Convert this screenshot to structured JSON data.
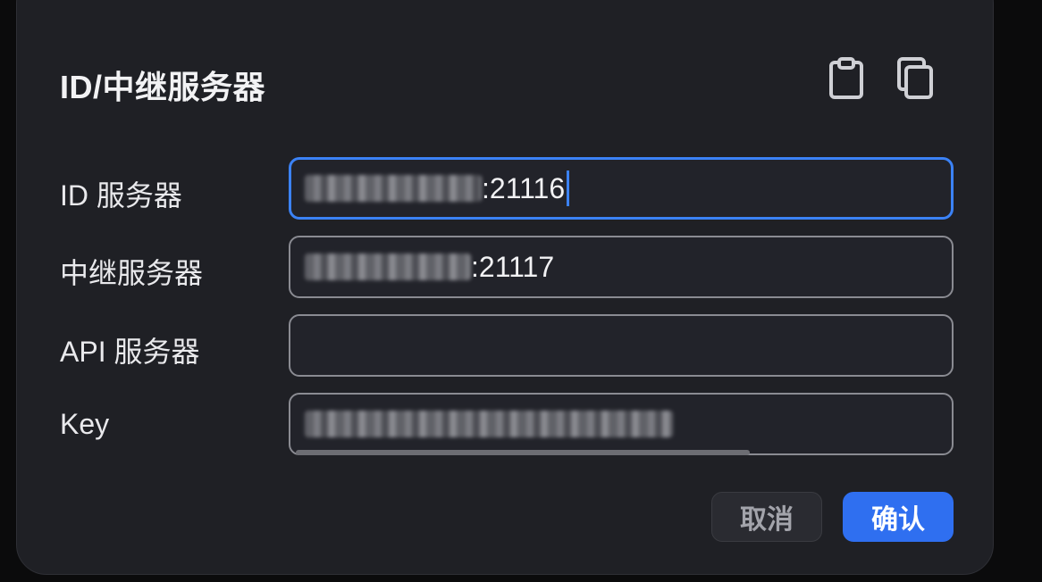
{
  "dialog": {
    "title": "ID/中继服务器",
    "icons": {
      "paste": "clipboard-paste-icon",
      "copy": "copy-icon"
    }
  },
  "fields": {
    "id_server": {
      "label": "ID 服务器",
      "value_visible": ":21116",
      "value_note_redacted": true
    },
    "relay_server": {
      "label": "中继服务器",
      "value_visible": ":21117",
      "value_note_redacted": true
    },
    "api_server": {
      "label": "API 服务器",
      "value_visible": ""
    },
    "key": {
      "label": "Key",
      "value_visible": "",
      "value_note_redacted": true
    }
  },
  "buttons": {
    "cancel": "取消",
    "confirm": "确认"
  },
  "colors": {
    "dialog_bg": "#1f2025",
    "accent": "#2f6ff0",
    "focus_border": "#3b82f6",
    "input_border": "#8a8b92"
  }
}
